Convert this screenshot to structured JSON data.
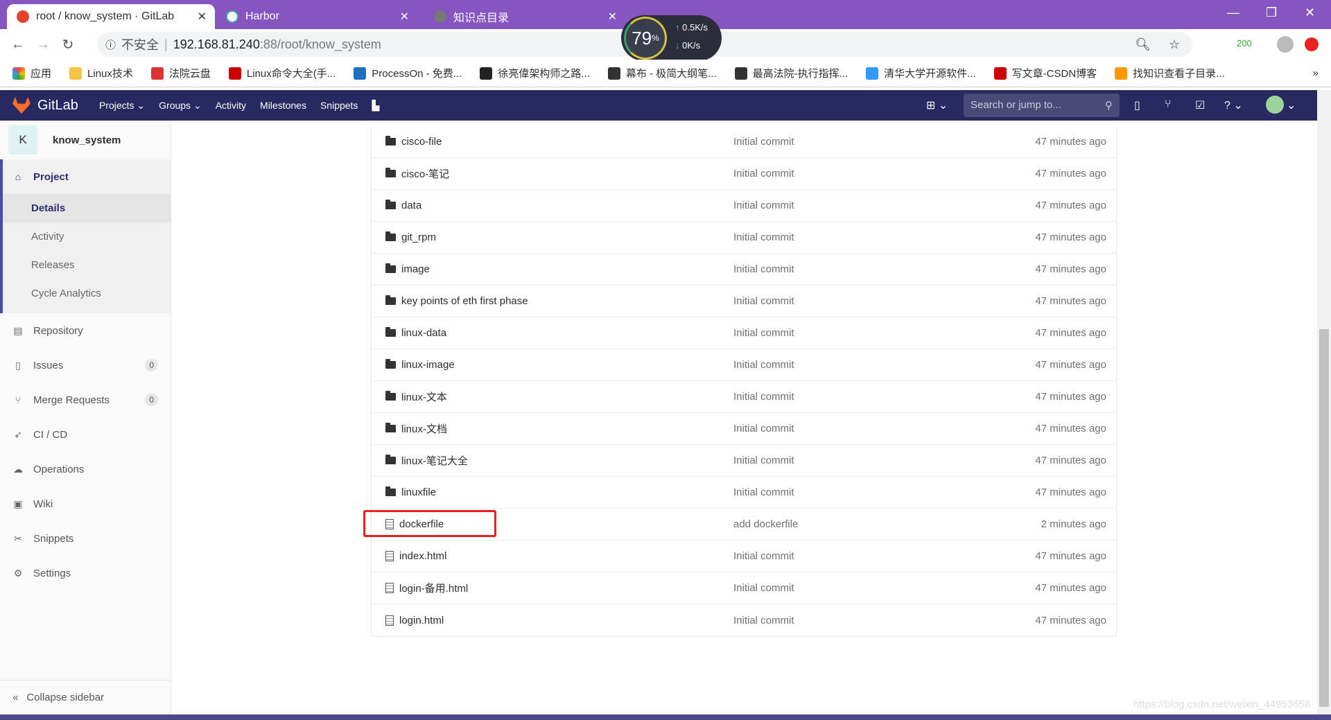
{
  "browser": {
    "tabs": [
      {
        "label": "root / know_system · GitLab",
        "active": true
      },
      {
        "label": "Harbor"
      },
      {
        "label": "知识点目录"
      }
    ],
    "security": "不安全",
    "url_host": "192.168.81.240",
    "url_path": ":88/root/know_system",
    "ext_badge": "200",
    "speed": {
      "percent": "79",
      "up": "0.5K/s",
      "down": "0K/s"
    },
    "bookmarks": [
      "应用",
      "Linux技术",
      "法院云盘",
      "Linux命令大全(手...",
      "ProcessOn - 免费...",
      "徐亮偉架构师之路...",
      "幕布 - 极简大纲笔...",
      "最高法院-执行指挥...",
      "清华大学开源软件...",
      "写文章-CSDN博客",
      "找知识查看子目录..."
    ],
    "bookmark_colors": [
      "#e44",
      "#f5c542",
      "#d33",
      "#c00",
      "#1e6fc0",
      "#222",
      "#333",
      "#333",
      "#39f",
      "#c00",
      "#f90"
    ]
  },
  "header": {
    "brand": "GitLab",
    "nav": [
      "Projects",
      "Groups",
      "Activity",
      "Milestones",
      "Snippets"
    ],
    "search_placeholder": "Search or jump to..."
  },
  "sidebar": {
    "avatar_letter": "K",
    "project_name": "know_system",
    "project_label": "Project",
    "project_sub": [
      "Details",
      "Activity",
      "Releases",
      "Cycle Analytics"
    ],
    "items": [
      {
        "label": "Repository",
        "icon": "repository-icon"
      },
      {
        "label": "Issues",
        "icon": "issues-icon",
        "count": "0"
      },
      {
        "label": "Merge Requests",
        "icon": "merge-request-icon",
        "count": "0"
      },
      {
        "label": "CI / CD",
        "icon": "rocket-icon"
      },
      {
        "label": "Operations",
        "icon": "operations-icon"
      },
      {
        "label": "Wiki",
        "icon": "book-icon"
      },
      {
        "label": "Snippets",
        "icon": "scissors-icon"
      },
      {
        "label": "Settings",
        "icon": "gear-icon"
      }
    ],
    "collapse": "Collapse sidebar"
  },
  "files": [
    {
      "name": "cisco-file",
      "type": "folder",
      "commit": "Initial commit",
      "time": "47 minutes ago"
    },
    {
      "name": "cisco-笔记",
      "type": "folder",
      "commit": "Initial commit",
      "time": "47 minutes ago"
    },
    {
      "name": "data",
      "type": "folder",
      "commit": "Initial commit",
      "time": "47 minutes ago"
    },
    {
      "name": "git_rpm",
      "type": "folder",
      "commit": "Initial commit",
      "time": "47 minutes ago"
    },
    {
      "name": "image",
      "type": "folder",
      "commit": "Initial commit",
      "time": "47 minutes ago"
    },
    {
      "name": "key points of eth first phase",
      "type": "folder",
      "commit": "Initial commit",
      "time": "47 minutes ago"
    },
    {
      "name": "linux-data",
      "type": "folder",
      "commit": "Initial commit",
      "time": "47 minutes ago"
    },
    {
      "name": "linux-image",
      "type": "folder",
      "commit": "Initial commit",
      "time": "47 minutes ago"
    },
    {
      "name": "linux-文本",
      "type": "folder",
      "commit": "Initial commit",
      "time": "47 minutes ago"
    },
    {
      "name": "linux-文档",
      "type": "folder",
      "commit": "Initial commit",
      "time": "47 minutes ago"
    },
    {
      "name": "linux-笔记大全",
      "type": "folder",
      "commit": "Initial commit",
      "time": "47 minutes ago"
    },
    {
      "name": "linuxfile",
      "type": "folder",
      "commit": "Initial commit",
      "time": "47 minutes ago"
    },
    {
      "name": "dockerfile",
      "type": "file",
      "commit": "add dockerfile",
      "time": "2 minutes ago",
      "highlighted": true
    },
    {
      "name": "index.html",
      "type": "file",
      "commit": "Initial commit",
      "time": "47 minutes ago"
    },
    {
      "name": "login-备用.html",
      "type": "file",
      "commit": "Initial commit",
      "time": "47 minutes ago"
    },
    {
      "name": "login.html",
      "type": "file",
      "commit": "Initial commit",
      "time": "47 minutes ago"
    }
  ],
  "watermark": "https://blog.csdn.net/weixin_44953658",
  "colors": {
    "tabbar": "#8655c0",
    "header": "#292961",
    "highlight": "#e8201e"
  }
}
